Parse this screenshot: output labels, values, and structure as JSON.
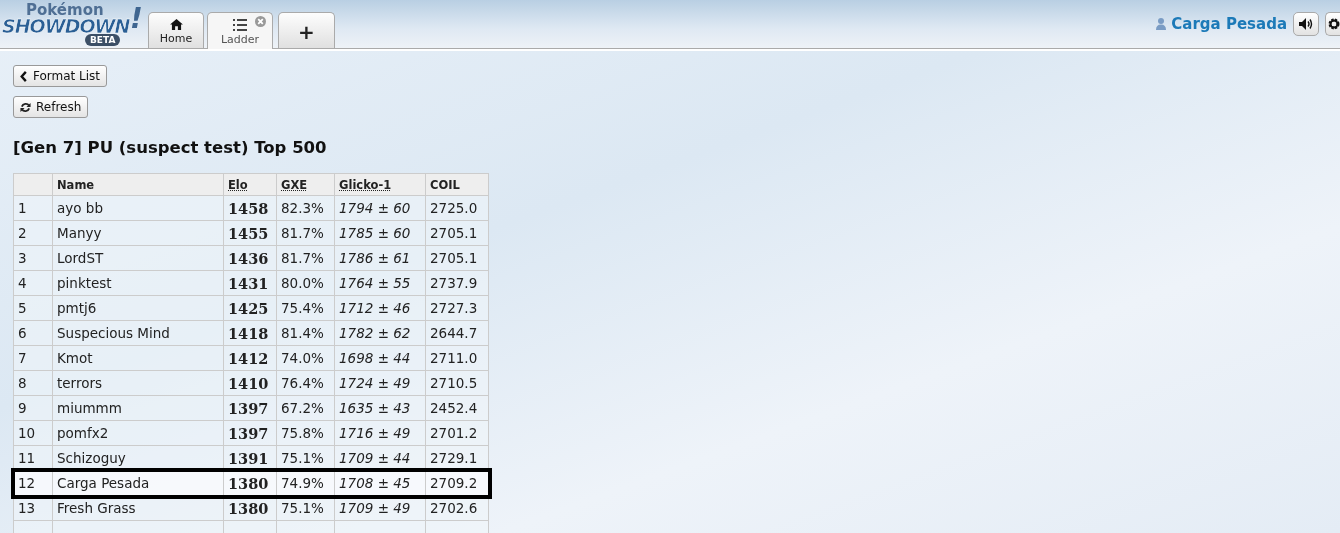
{
  "header": {
    "logo": {
      "top": "Pokémon",
      "main": "SHOWDOWN",
      "mark": "!",
      "badge": "BETA"
    },
    "tabs": [
      {
        "label": "Home",
        "kind": "home",
        "selected": false,
        "closable": false
      },
      {
        "label": "Ladder",
        "kind": "list",
        "selected": true,
        "closable": true
      },
      {
        "label": "+",
        "kind": "new",
        "selected": false,
        "closable": false
      }
    ],
    "user": {
      "name": "Carga Pesada"
    }
  },
  "buttons": [
    {
      "label": "Format List",
      "kind": "back"
    },
    {
      "label": "Refresh",
      "kind": "refresh"
    }
  ],
  "title": "[Gen 7] PU (suspect test) Top 500",
  "table": {
    "columns": [
      "",
      "Name",
      "Elo",
      "GXE",
      "Glicko-1",
      "COIL"
    ],
    "rows": [
      {
        "rank": "1",
        "name": "ayo bb",
        "elo": "1458",
        "gxe": "82.3%",
        "glicko": "1794 ± 60",
        "coil": "2725.0",
        "highlighted": false
      },
      {
        "rank": "2",
        "name": "Manyy",
        "elo": "1455",
        "gxe": "81.7%",
        "glicko": "1785 ± 60",
        "coil": "2705.1",
        "highlighted": false
      },
      {
        "rank": "3",
        "name": "LordST",
        "elo": "1436",
        "gxe": "81.7%",
        "glicko": "1786 ± 61",
        "coil": "2705.1",
        "highlighted": false
      },
      {
        "rank": "4",
        "name": "pinktest",
        "elo": "1431",
        "gxe": "80.0%",
        "glicko": "1764 ± 55",
        "coil": "2737.9",
        "highlighted": false
      },
      {
        "rank": "5",
        "name": "pmtj6",
        "elo": "1425",
        "gxe": "75.4%",
        "glicko": "1712 ± 46",
        "coil": "2727.3",
        "highlighted": false
      },
      {
        "rank": "6",
        "name": "Suspecious Mind",
        "elo": "1418",
        "gxe": "81.4%",
        "glicko": "1782 ± 62",
        "coil": "2644.7",
        "highlighted": false
      },
      {
        "rank": "7",
        "name": "Kmot",
        "elo": "1412",
        "gxe": "74.0%",
        "glicko": "1698 ± 44",
        "coil": "2711.0",
        "highlighted": false
      },
      {
        "rank": "8",
        "name": "terrors",
        "elo": "1410",
        "gxe": "76.4%",
        "glicko": "1724 ± 49",
        "coil": "2710.5",
        "highlighted": false
      },
      {
        "rank": "9",
        "name": "miummm",
        "elo": "1397",
        "gxe": "67.2%",
        "glicko": "1635 ± 43",
        "coil": "2452.4",
        "highlighted": false
      },
      {
        "rank": "10",
        "name": "pomfx2",
        "elo": "1397",
        "gxe": "75.8%",
        "glicko": "1716 ± 49",
        "coil": "2701.2",
        "highlighted": false
      },
      {
        "rank": "11",
        "name": "Schizoguy",
        "elo": "1391",
        "gxe": "75.1%",
        "glicko": "1709 ± 44",
        "coil": "2729.1",
        "highlighted": false
      },
      {
        "rank": "12",
        "name": "Carga Pesada",
        "elo": "1380",
        "gxe": "74.9%",
        "glicko": "1708 ± 45",
        "coil": "2709.2",
        "highlighted": true
      },
      {
        "rank": "13",
        "name": "Fresh Grass",
        "elo": "1380",
        "gxe": "75.1%",
        "glicko": "1709 ± 49",
        "coil": "2702.6",
        "highlighted": false
      }
    ]
  }
}
